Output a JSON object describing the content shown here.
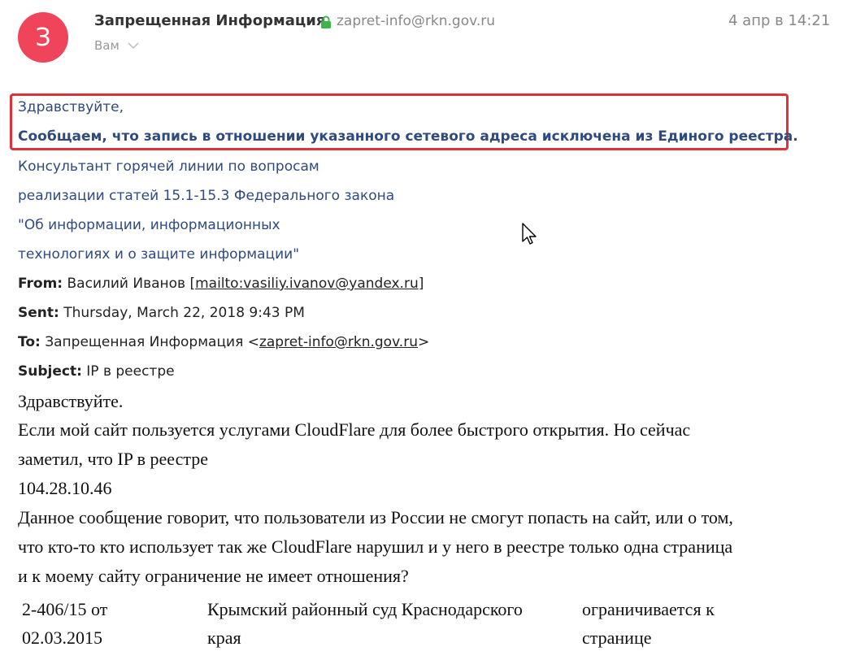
{
  "header": {
    "avatar_letter": "З",
    "sender_name": "Запрещенная Информация",
    "sender_email": "zapret-info@rkn.gov.ru",
    "date": "4 апр в 14:21",
    "recipient": "Вам"
  },
  "reply": {
    "greeting": "Здравствуйте,",
    "notice": "Сообщаем, что запись  в отношении указанного сетевого адреса исключена из Единого реестра.",
    "signature": [
      "Консультант горячей линии по вопросам",
      "реализации статей 15.1-15.3 Федерального закона",
      "\"Об информации, информационных",
      "технологиях и о защите информации\""
    ]
  },
  "quoted": {
    "from_label": "From:",
    "from_name": "Василий Иванов [",
    "from_link": "mailto:vasiliy.ivanov@yandex.ru",
    "from_end": "]",
    "sent_label": "Sent:",
    "sent_value": "Thursday, March 22, 2018 9:43 PM",
    "to_label": "To:",
    "to_name": "Запрещенная Информация <",
    "to_link": "zapret-info@rkn.gov.ru",
    "to_end": ">",
    "subject_label": "Subject:",
    "subject_value": "IP в реестре"
  },
  "message": {
    "lines": [
      "Здравствуйте.",
      "Если мой сайт пользуется услугами CloudFlare для более быстрого открытия. Но сейчас",
      "заметил, что IP в реестре",
      "104.28.10.46",
      "Данное сообщение говорит, что пользователи из России не смогут попасть на сайт, или о том,",
      "что кто-то кто использует так же CloudFlare нарушил и у него в реестре только одна страница",
      "и к моему сайту ограничение не имеет отношения?"
    ]
  },
  "registry_row": {
    "col1_line1": "2-406/15 от",
    "col1_line2": "02.03.2015",
    "col2_line1": "Крымский районный суд Краснодарского",
    "col2_line2": "края",
    "col3_line1": "ограничивается к",
    "col3_line2": "странице"
  },
  "colors": {
    "avatar": "#f0445a",
    "lock": "#3cb44a",
    "reply_text": "#2e4a7f",
    "highlight_border": "#e0303a"
  },
  "icons": [
    "lock-icon",
    "chevron-down-icon",
    "mouse-cursor-icon"
  ]
}
